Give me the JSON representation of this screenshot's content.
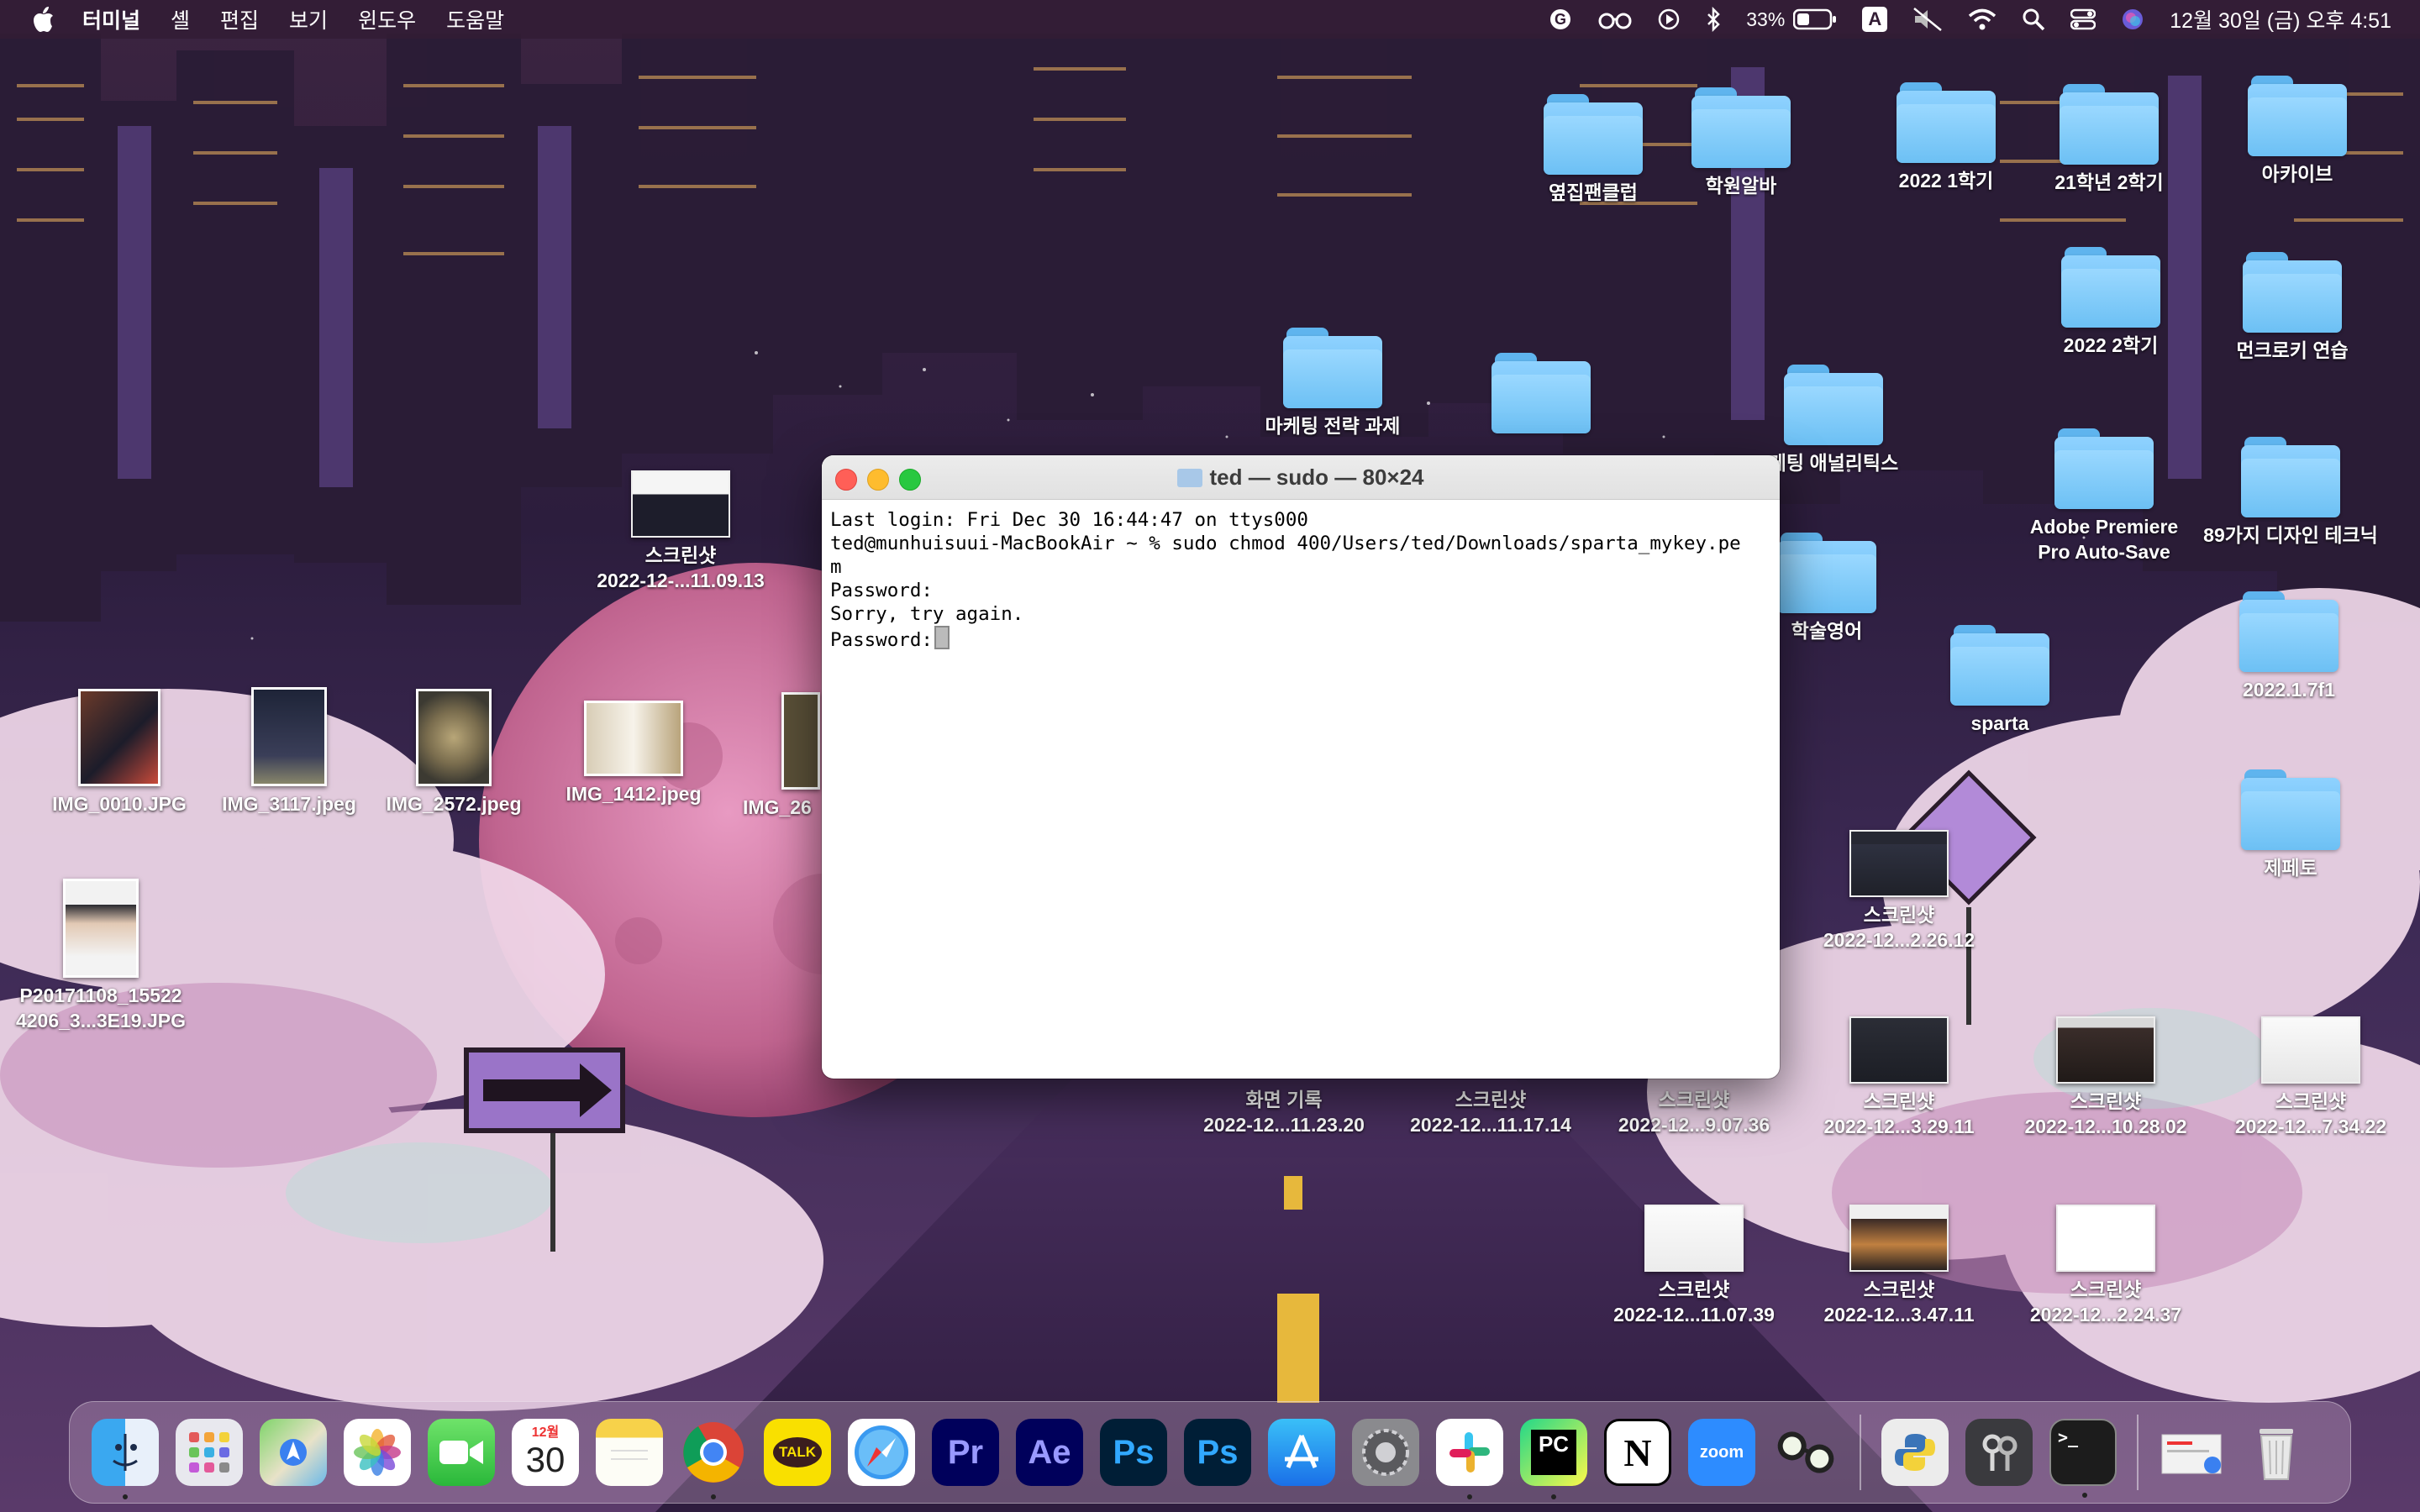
{
  "menubar": {
    "app_name": "터미널",
    "menus": [
      "셸",
      "편집",
      "보기",
      "윈도우",
      "도움말"
    ],
    "battery": "33%",
    "input_source": "A",
    "datetime": "12월 30일 (금) 오후 4:51"
  },
  "terminal": {
    "title": "ted — sudo — 80×24",
    "lines": [
      "Last login: Fri Dec 30 16:44:47 on ttys000",
      "ted@munhuisuui-MacBookAir ~ % sudo chmod 400/Users/ted/Downloads/sparta_mykey.pe",
      "m",
      "Password:",
      "Sorry, try again.",
      "Password:"
    ]
  },
  "desktop": {
    "folders": [
      {
        "label": "옆집팬클럽"
      },
      {
        "label": "학원알바"
      },
      {
        "label": "2022 1학기"
      },
      {
        "label": "21학년 2학기"
      },
      {
        "label": "아카이브"
      },
      {
        "label": "2022 2학기"
      },
      {
        "label": "먼크로키 연습"
      },
      {
        "label": "마케팅 전략 과제"
      },
      {
        "label": ""
      },
      {
        "label": "케팅 애널리틱스"
      },
      {
        "label": "Adobe Premiere Pro Auto-Save"
      },
      {
        "label": "89가지 디자인 테크닉"
      },
      {
        "label": "학술영어"
      },
      {
        "label": "sparta"
      },
      {
        "label": "2022.1.7f1"
      },
      {
        "label": "제페토"
      }
    ],
    "files": [
      {
        "line1": "스크린샷",
        "line2": "2022-12-...11.09.13"
      },
      {
        "line1": "IMG_0010.JPG",
        "line2": ""
      },
      {
        "line1": "IMG_3117.jpeg",
        "line2": ""
      },
      {
        "line1": "IMG_2572.jpeg",
        "line2": ""
      },
      {
        "line1": "IMG_1412.jpeg",
        "line2": ""
      },
      {
        "line1": "IMG_26",
        "line2": ""
      },
      {
        "line1": "P20171108_15522",
        "line2": "4206_3...3E19.JPG"
      },
      {
        "line1": "스크린샷",
        "line2": "2022-12...2.26.12"
      },
      {
        "line1": "화면 기록",
        "line2": "2022-12...11.23.20"
      },
      {
        "line1": "스크린샷",
        "line2": "2022-12...11.17.14"
      },
      {
        "line1": "스크린샷",
        "line2": "2022-12...9.07.36"
      },
      {
        "line1": "스크린샷",
        "line2": "2022-12...3.29.11"
      },
      {
        "line1": "스크린샷",
        "line2": "2022-12...10.28.02"
      },
      {
        "line1": "스크린샷",
        "line2": "2022-12...7.34.22"
      },
      {
        "line1": "스크린샷",
        "line2": "2022-12...11.07.39"
      },
      {
        "line1": "스크린샷",
        "line2": "2022-12...3.47.11"
      },
      {
        "line1": "스크린샷",
        "line2": "2022-12...2.24.37"
      }
    ]
  },
  "dock": {
    "calendar_month": "12월",
    "calendar_day": "30",
    "kakao_label": "TALK",
    "premiere_label": "Pr",
    "aftereffects_label": "Ae",
    "photoshop_label": "Ps",
    "photoshop2_label": "Ps",
    "pycharm_label": "PC",
    "notion_label": "N",
    "zoom_label": "zoom",
    "terminal_label": ">_"
  },
  "colors": {
    "menubar_bg": "#321c34",
    "folder_blue": "#6cc0f4",
    "terminal_close": "#ff5f57",
    "terminal_minimize": "#febc2e",
    "terminal_zoom": "#28c840"
  }
}
